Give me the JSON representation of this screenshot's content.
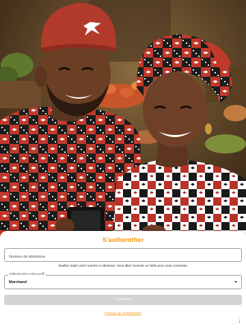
{
  "auth": {
    "title": "S'authentifier",
    "phone_placeholder": "Numéro de téléphone",
    "hint": "Veuillez saisir votre numéro ci-dessous. Vous allez recevoir un SMS pour vous connecter.",
    "profile_label": "Sélectionnez votre profil",
    "profile_value": "Marchand",
    "continue_label": "Continuer",
    "privacy_link": "Politique de confidentialité"
  },
  "icons": {
    "profile_dropdown": "chevron-down-icon",
    "overflow_menu": "more-vertical-icon"
  },
  "colors": {
    "accent": "#f39a1d",
    "button_disabled": "#d3d3d3",
    "hat_red": "#b23a2a"
  }
}
